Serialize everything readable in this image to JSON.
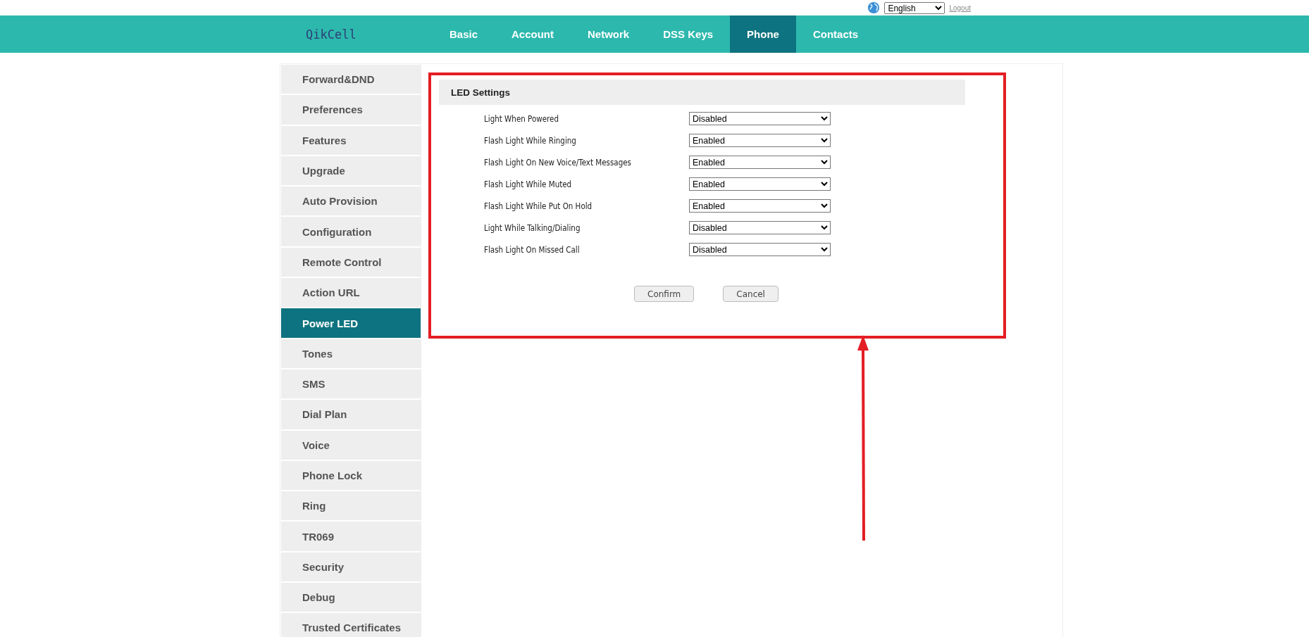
{
  "top_bar": {
    "language": "English",
    "logout": "Logout"
  },
  "header": {
    "logo": "QikCell",
    "tabs": [
      {
        "label": "Basic",
        "selected": false
      },
      {
        "label": "Account",
        "selected": false
      },
      {
        "label": "Network",
        "selected": false
      },
      {
        "label": "DSS Keys",
        "selected": false
      },
      {
        "label": "Phone",
        "selected": true
      },
      {
        "label": "Contacts",
        "selected": false
      }
    ]
  },
  "sidebar": {
    "items": [
      {
        "label": "Forward&DND",
        "selected": false
      },
      {
        "label": "Preferences",
        "selected": false
      },
      {
        "label": "Features",
        "selected": false
      },
      {
        "label": "Upgrade",
        "selected": false
      },
      {
        "label": "Auto Provision",
        "selected": false
      },
      {
        "label": "Configuration",
        "selected": false
      },
      {
        "label": "Remote Control",
        "selected": false
      },
      {
        "label": "Action URL",
        "selected": false
      },
      {
        "label": "Power LED",
        "selected": true
      },
      {
        "label": "Tones",
        "selected": false
      },
      {
        "label": "SMS",
        "selected": false
      },
      {
        "label": "Dial Plan",
        "selected": false
      },
      {
        "label": "Voice",
        "selected": false
      },
      {
        "label": "Phone Lock",
        "selected": false
      },
      {
        "label": "Ring",
        "selected": false
      },
      {
        "label": "TR069",
        "selected": false
      },
      {
        "label": "Security",
        "selected": false
      },
      {
        "label": "Debug",
        "selected": false
      },
      {
        "label": "Trusted Certificates",
        "selected": false
      }
    ]
  },
  "panel": {
    "title": "LED Settings",
    "settings": [
      {
        "label": "Light When Powered",
        "value": "Disabled"
      },
      {
        "label": "Flash Light While Ringing",
        "value": "Enabled"
      },
      {
        "label": "Flash Light On New Voice/Text Messages",
        "value": "Enabled"
      },
      {
        "label": "Flash Light While Muted",
        "value": "Enabled"
      },
      {
        "label": "Flash Light While Put On Hold",
        "value": "Enabled"
      },
      {
        "label": "Light While Talking/Dialing",
        "value": "Disabled"
      },
      {
        "label": "Flash Light On Missed Call",
        "value": "Disabled"
      }
    ],
    "buttons": [
      "Confirm",
      "Cancel"
    ]
  }
}
